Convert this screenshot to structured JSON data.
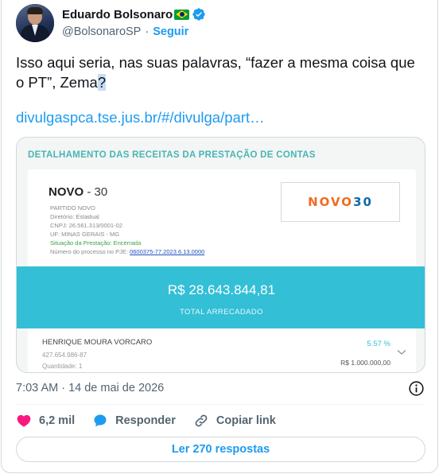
{
  "author": {
    "name": "Eduardo Bolsonaro",
    "handle": "@BolsonaroSP",
    "separator": "·",
    "follow_label": "Seguir"
  },
  "tweet": {
    "text_before": "Isso aqui seria, nas suas palavras, “fazer a mesma coisa que o PT”, Zema",
    "text_highlight": "?",
    "link_text": "divulgaspca.tse.jus.br/#/divulga/part…"
  },
  "media": {
    "title": "DETALHAMENTO DAS RECEITAS DA PRESTAÇÃO DE CONTAS",
    "party": {
      "name": "NOVO",
      "number": "- 30",
      "full_name": "PARTIDO NOVO",
      "directory": "Diretório: Estadual",
      "cnpj": "CNPJ: 26.561.313/0001-02",
      "uf": "UF: MINAS GERAIS - MG",
      "status": "Situação da Prestação: Encerrada",
      "process_label": "Número do processo no PJE:",
      "process_number": "0600375-77.2023.6.13.0000",
      "logo_left": "NOVO",
      "logo_right": "30"
    },
    "total_amount": "R$ 28.643.844,81",
    "total_label": "TOTAL ARRECADADO",
    "donor": {
      "name": "HENRIQUE MOURA VORCARO",
      "id": "427.654.986-87",
      "quantity": "Quantidade: 1",
      "percent": "5.57 %",
      "amount": "R$ 1.000.000,00"
    }
  },
  "timestamp": "7:03 AM · 14 de mai de 2026",
  "actions": {
    "likes": "6,2 mil",
    "reply": "Responder",
    "copy": "Copiar link"
  },
  "read_replies": "Ler 270 respostas",
  "colors": {
    "accent": "#1d9bf0",
    "heart": "#f91880",
    "band": "#33bfd6",
    "verified": "#1d9bf0"
  }
}
